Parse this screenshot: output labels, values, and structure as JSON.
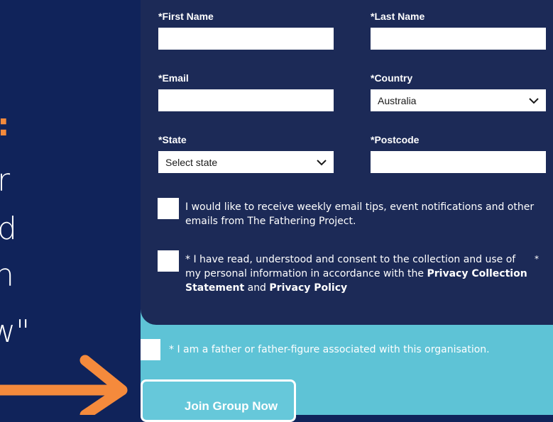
{
  "left_panel": {
    "fragments": [
      ":",
      "r",
      "d",
      "n",
      "w\""
    ]
  },
  "form": {
    "first_name": {
      "label": "*First Name",
      "value": ""
    },
    "last_name": {
      "label": "*Last Name",
      "value": ""
    },
    "email": {
      "label": "*Email",
      "value": ""
    },
    "country": {
      "label": "*Country",
      "selected": "Australia"
    },
    "state": {
      "label": "*State",
      "selected": "Select state"
    },
    "postcode": {
      "label": "*Postcode",
      "value": ""
    },
    "consent_emails": {
      "text": "I would like to receive weekly email tips, event notifications and other emails from The Fathering Project."
    },
    "consent_privacy": {
      "text_prefix": "* I have read, understood and consent to the collection and use of my personal information in accordance with the",
      "privacy_collection": "Privacy Collection Statement",
      "and": "and",
      "privacy_policy": "Privacy Policy",
      "required_mark": "*"
    }
  },
  "father_checkbox": {
    "text": "* I am a father or father-figure associated with this organisation."
  },
  "join_button": {
    "label": "Join Group Now"
  },
  "colors": {
    "background": "#10235a",
    "card": "#1c2a57",
    "teal": "#5ec3d6",
    "orange": "#f58a3c"
  },
  "icons": {
    "select_chevron": "chevron-down-icon",
    "arrow": "arrow-right-icon"
  }
}
